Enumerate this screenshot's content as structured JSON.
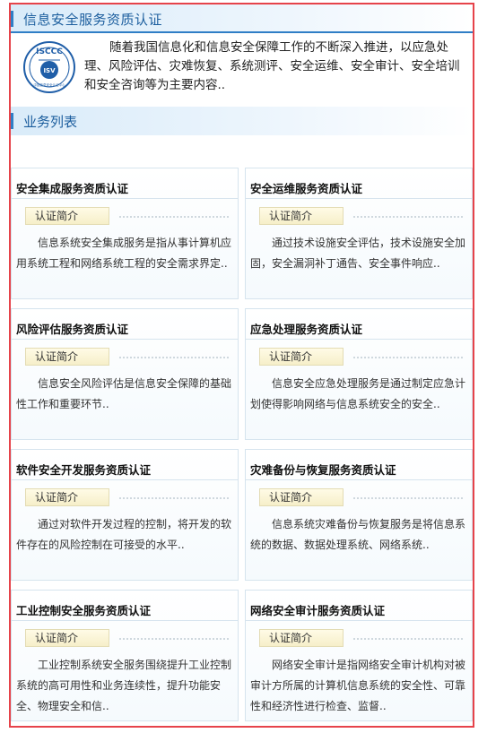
{
  "header": {
    "title": "信息安全服务资质认证",
    "intro": "随着我国信息化和信息安全保障工作的不断深入推进，以应急处理、风险评估、灾难恢复、系统测评、安全运维、安全审计、安全培训和安全咨询等为主要内容.."
  },
  "logo": {
    "top_text": "ISCCC",
    "center_text": "ISV",
    "bottom_text": "中国信息安全认证中心"
  },
  "business": {
    "title": "业务列表",
    "items": [
      {
        "title": "安全集成服务资质认证",
        "tag": "认证简介",
        "desc": "信息系统安全集成服务是指从事计算机应用系统工程和网络系统工程的安全需求界定.."
      },
      {
        "title": "安全运维服务资质认证",
        "tag": "认证简介",
        "desc": "通过技术设施安全评估，技术设施安全加固，安全漏洞补丁通告、安全事件响应.."
      },
      {
        "title": "风险评估服务资质认证",
        "tag": "认证简介",
        "desc": "信息安全风险评估是信息安全保障的基础性工作和重要环节.."
      },
      {
        "title": "应急处理服务资质认证",
        "tag": "认证简介",
        "desc": "信息安全应急处理服务是通过制定应急计划使得影响网络与信息系统安全的安全.."
      },
      {
        "title": "软件安全开发服务资质认证",
        "tag": "认证简介",
        "desc": "通过对软件开发过程的控制，将开发的软件存在的风险控制在可接受的水平.."
      },
      {
        "title": "灾难备份与恢复服务资质认证",
        "tag": "认证简介",
        "desc": "信息系统灾难备份与恢复服务是将信息系统的数据、数据处理系统、网络系统.."
      },
      {
        "title": "工业控制安全服务资质认证",
        "tag": "认证简介",
        "desc": "工业控制系统安全服务围绕提升工业控制系统的高可用性和业务连续性，提升功能安全、物理安全和信.."
      },
      {
        "title": "网络安全审计服务资质认证",
        "tag": "认证简介",
        "desc": "网络安全审计是指网络安全审计机构对被审计方所属的计算机信息系统的安全性、可靠性和经济性进行检查、监督.."
      }
    ]
  },
  "colors": {
    "border": "#e6434a",
    "accent": "#2f7ec6",
    "title": "#1c5e9e"
  }
}
